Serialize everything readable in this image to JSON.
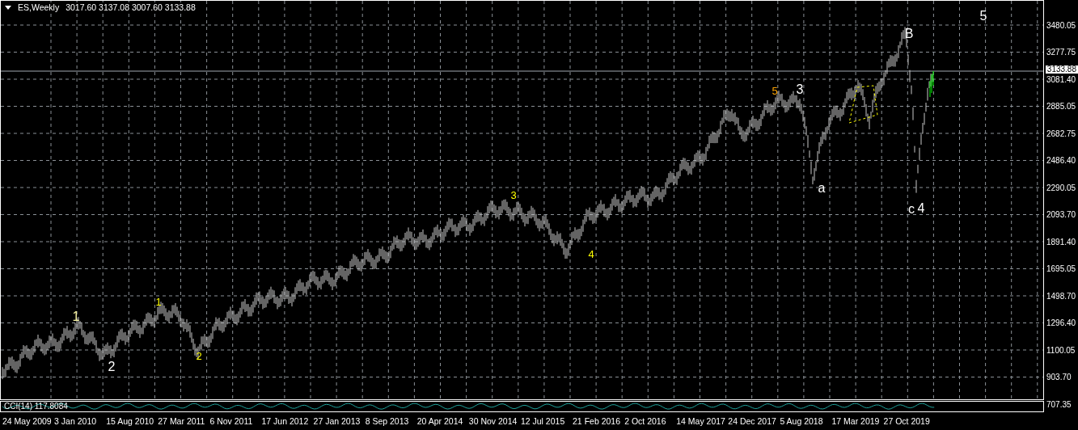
{
  "header": {
    "symbol": "ES,Weekly",
    "ohlc": "3017.60 3137.08 3007.60 3133.88"
  },
  "price_axis": {
    "labels": [
      "3480.05",
      "3277.75",
      "3081.40",
      "2885.05",
      "2682.75",
      "2486.40",
      "2290.05",
      "2093.70",
      "1891.40",
      "1695.05",
      "1498.70",
      "1296.40",
      "1100.05",
      "903.70",
      "707.35"
    ],
    "current_price": "3133.88"
  },
  "wave_labels": [
    {
      "text": "1",
      "color": "#f5f0a0"
    },
    {
      "text": "2",
      "color": "#ffffff"
    },
    {
      "text": "1",
      "color": "#ffff00"
    },
    {
      "text": "2",
      "color": "#ffff00"
    },
    {
      "text": "3",
      "color": "#ffff00"
    },
    {
      "text": "4",
      "color": "#ffff00"
    },
    {
      "text": "5",
      "color": "#ffa500"
    },
    {
      "text": "3",
      "color": "#ffffff"
    },
    {
      "text": "a",
      "color": "#ffffff"
    },
    {
      "text": "B",
      "color": "#ffffff"
    },
    {
      "text": "c",
      "color": "#ffffff"
    },
    {
      "text": "4",
      "color": "#ffffff"
    },
    {
      "text": "5",
      "color": "#ffffff"
    }
  ],
  "indicator": {
    "label": "CCI(14) 117.8084"
  },
  "time_axis": {
    "labels": [
      "24 May 2009",
      "3 Jan 2010",
      "15 Aug 2010",
      "27 Mar 2011",
      "6 Nov 2011",
      "17 Jun 2012",
      "27 Jan 2013",
      "8 Sep 2013",
      "20 Apr 2014",
      "30 Nov 2014",
      "12 Jul 2015",
      "21 Feb 2016",
      "2 Oct 2016",
      "14 May 2017",
      "24 Dec 2017",
      "5 Aug 2018",
      "17 Mar 2019",
      "27 Oct 2019"
    ]
  }
}
